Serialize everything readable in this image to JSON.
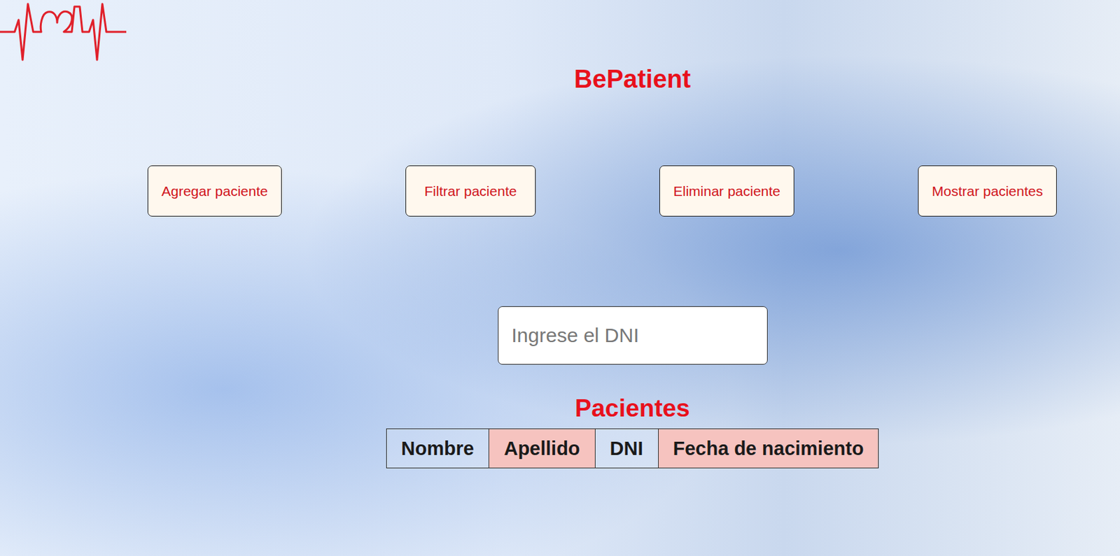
{
  "app": {
    "title": "BePatient"
  },
  "actions": [
    "Agregar paciente",
    "Filtrar paciente",
    "Eliminar paciente",
    "Mostrar pacientes"
  ],
  "search": {
    "placeholder": "Ingrese el DNI"
  },
  "table": {
    "title": "Pacientes",
    "columns": [
      "Nombre",
      "Apellido",
      "DNI",
      "Fecha de nacimiento"
    ]
  }
}
